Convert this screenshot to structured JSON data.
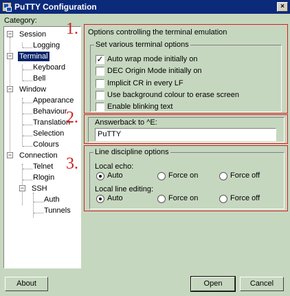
{
  "window": {
    "title": "PuTTY Configuration"
  },
  "category_label": "Category:",
  "tree": [
    {
      "label": "Session",
      "expander": "−"
    },
    {
      "label": "Logging"
    },
    {
      "label": "Terminal",
      "expander": "−",
      "selected": true
    },
    {
      "label": "Keyboard"
    },
    {
      "label": "Bell"
    },
    {
      "label": "Window",
      "expander": "−"
    },
    {
      "label": "Appearance"
    },
    {
      "label": "Behaviour"
    },
    {
      "label": "Translation"
    },
    {
      "label": "Selection"
    },
    {
      "label": "Colours"
    },
    {
      "label": "Connection",
      "expander": "−"
    },
    {
      "label": "Telnet"
    },
    {
      "label": "Rlogin"
    },
    {
      "label": "SSH",
      "expander": "−"
    },
    {
      "label": "Auth"
    },
    {
      "label": "Tunnels"
    }
  ],
  "annotations": {
    "one": "1.",
    "two": "2.",
    "three": "3."
  },
  "panel": {
    "header": "Options controlling the terminal emulation",
    "section1": {
      "title": "Set various terminal options",
      "options": [
        {
          "label": "Auto wrap mode initially on",
          "checked": true,
          "check_glyph": "✓"
        },
        {
          "label": "DEC Origin Mode initially on",
          "checked": false
        },
        {
          "label": "Implicit CR in every LF",
          "checked": false
        },
        {
          "label": "Use background colour to erase screen",
          "checked": false
        },
        {
          "label": "Enable blinking text",
          "checked": false
        }
      ]
    },
    "section2": {
      "label": "Answerback to ^E:",
      "value": "PuTTY"
    },
    "section3": {
      "title": "Line discipline options",
      "local_echo": {
        "label": "Local echo:",
        "options": [
          "Auto",
          "Force on",
          "Force off"
        ],
        "selected": "Auto"
      },
      "local_line_editing": {
        "label": "Local line editing:",
        "options": [
          "Auto",
          "Force on",
          "Force off"
        ],
        "selected": "Auto"
      }
    }
  },
  "buttons": {
    "about": "About",
    "open": "Open",
    "cancel": "Cancel",
    "close": "×"
  },
  "colors": {
    "accent": "#d02020",
    "titlebar": "#0b2a7a",
    "background": "#c6d7bf",
    "selection": "#0a246a"
  }
}
